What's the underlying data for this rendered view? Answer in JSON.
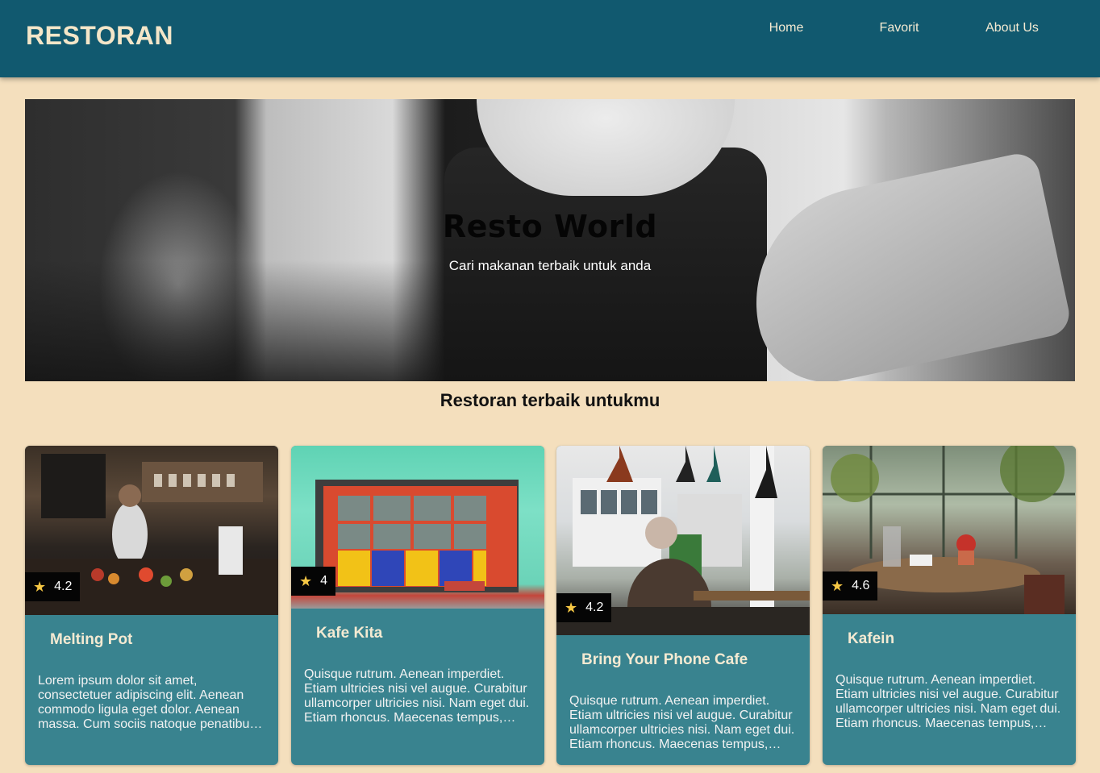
{
  "header": {
    "brand": "RESTORAN",
    "nav": [
      {
        "label": "Home"
      },
      {
        "label": "Favorit"
      },
      {
        "label": "About Us"
      }
    ]
  },
  "hero": {
    "title": "Resto World",
    "subtitle": "Cari makanan terbaik untuk anda"
  },
  "section": {
    "title": "Restoran terbaik untukmu"
  },
  "restaurants": [
    {
      "name": "Melting Pot",
      "rating": "4.2",
      "description": "Lorem ipsum dolor sit amet, consectetuer adipiscing elit. Aenean commodo ligula eget dolor. Aenean massa. Cum sociis natoque penatibus et magnis dis parturient montes."
    },
    {
      "name": "Kafe Kita",
      "rating": "4",
      "description": "Quisque rutrum. Aenean imperdiet. Etiam ultricies nisi vel augue. Curabitur ullamcorper ultricies nisi. Nam eget dui. Etiam rhoncus. Maecenas tempus, tellus eget condimentum."
    },
    {
      "name": "Bring Your Phone Cafe",
      "rating": "4.2",
      "description": "Quisque rutrum. Aenean imperdiet. Etiam ultricies nisi vel augue. Curabitur ullamcorper ultricies nisi. Nam eget dui. Etiam rhoncus. Maecenas tempus, tellus eget condimentum."
    },
    {
      "name": "Kafein",
      "rating": "4.6",
      "description": "Quisque rutrum. Aenean imperdiet. Etiam ultricies nisi vel augue. Curabitur ullamcorper ultricies nisi. Nam eget dui. Etiam rhoncus. Maecenas tempus, tellus eget condimentum."
    }
  ],
  "icons": {
    "rating": "star-icon"
  },
  "colors": {
    "header_bg": "#11596f",
    "page_bg": "#f4dfbd",
    "card_bg": "#39838f",
    "star": "#f6c744"
  }
}
